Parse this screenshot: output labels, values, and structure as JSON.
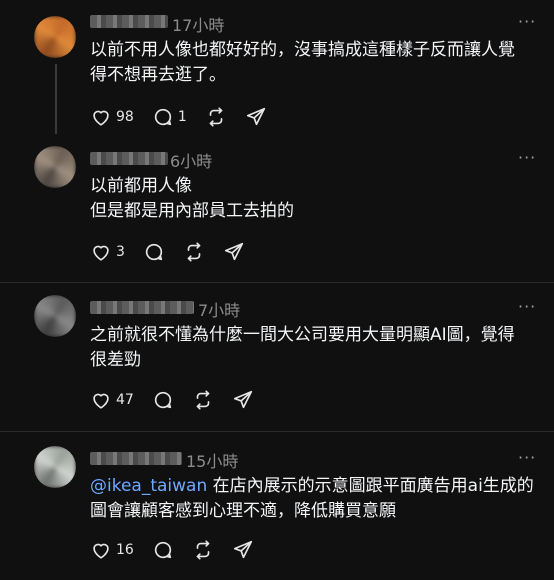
{
  "posts": [
    {
      "time": "17小時",
      "text": "以前不用人像也都好好的，沒事搞成這種樣子反而讓人覺\n得不想再去逛了。",
      "likes": "98",
      "replies": "1",
      "more": "···",
      "avatar_colors": [
        "#c46a2a",
        "#e08a3a",
        "#8f4a20"
      ]
    },
    {
      "time": "6小時",
      "text": "以前都用人像\n但是都是用內部員工去拍的",
      "likes": "3",
      "replies": "",
      "more": "···",
      "avatar_colors": [
        "#6b5f54",
        "#a09080",
        "#4c4540"
      ]
    },
    {
      "time": "7小時",
      "text": "之前就很不懂為什麼一間大公司要用大量明顯AI圖，覺得\n很差勁",
      "likes": "47",
      "replies": "",
      "more": "···",
      "avatar_colors": [
        "#5a5a5a",
        "#8a8a8a",
        "#3e3e3e"
      ]
    },
    {
      "time": "15小時",
      "mention": "@ikea_taiwan",
      "text": " 在店內展示的示意圖跟平面廣告用ai生成的\n圖會讓顧客感到心理不適，降低購買意願",
      "likes": "16",
      "replies": "",
      "more": "···",
      "avatar_colors": [
        "#9aa09a",
        "#d0d4d0",
        "#6f736f"
      ]
    }
  ]
}
